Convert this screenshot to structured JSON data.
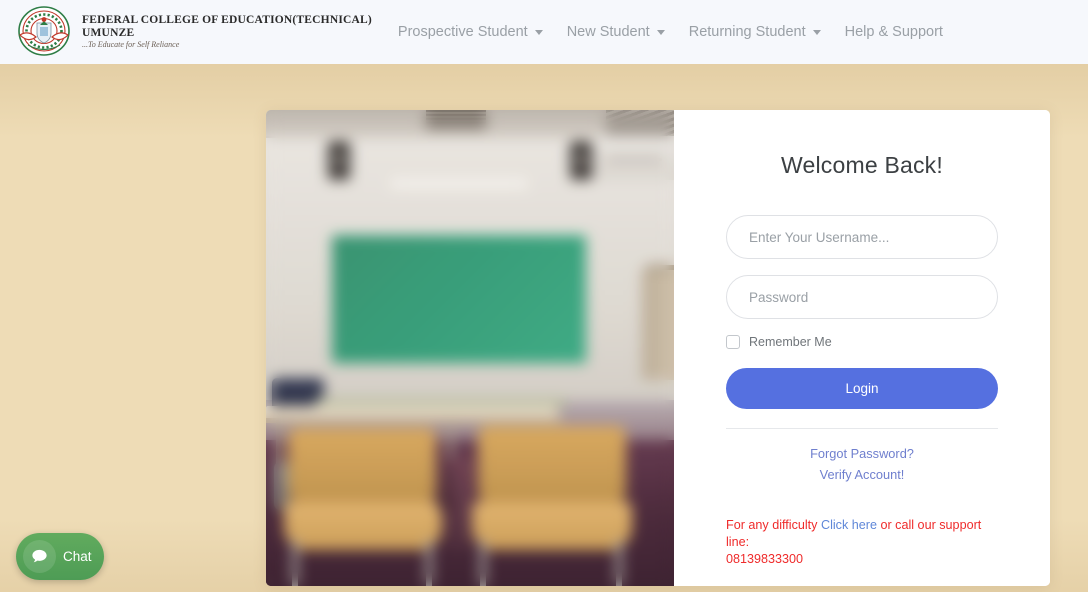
{
  "header": {
    "brand": {
      "logo_icon": "fce-umunze-crest",
      "line1": "FEDERAL COLLEGE OF EDUCATION(TECHNICAL)",
      "line2": "UMUNZE",
      "tagline": "...To Educate for Self Reliance"
    },
    "nav": [
      {
        "label": "Prospective Student",
        "has_dropdown": true,
        "caret_icon": "chevron-down-icon"
      },
      {
        "label": "New Student",
        "has_dropdown": true,
        "caret_icon": "chevron-down-icon"
      },
      {
        "label": "Returning Student",
        "has_dropdown": true,
        "caret_icon": "chevron-down-icon"
      },
      {
        "label": "Help & Support",
        "has_dropdown": false,
        "caret_icon": ""
      }
    ]
  },
  "card": {
    "photo": {
      "alt": "blurred classroom with green chalkboard, desk and two wooden chairs"
    },
    "login": {
      "heading": "Welcome Back!",
      "username_placeholder": "Enter Your Username...",
      "username_value": "",
      "password_placeholder": "Password",
      "password_value": "",
      "remember_label": "Remember Me",
      "remember_checked": false,
      "login_label": "Login",
      "forgot_label": "Forgot Password?",
      "verify_label": "Verify Account!",
      "support_prefix": "For any difficulty ",
      "support_link": "Click here",
      "support_middle": " or call our support line:",
      "support_phone": "08139833300"
    }
  },
  "chat": {
    "label": "Chat",
    "icon": "speech-bubble-icon"
  },
  "colors": {
    "header_bg": "#f6f8fc",
    "page_bg": "#eedcb6",
    "primary_button": "#5570e0",
    "link": "#6f7fce",
    "alert_text": "#ef2b2b",
    "chat_green": "#4e9c55",
    "chalkboard_green": "#2e9b74"
  }
}
